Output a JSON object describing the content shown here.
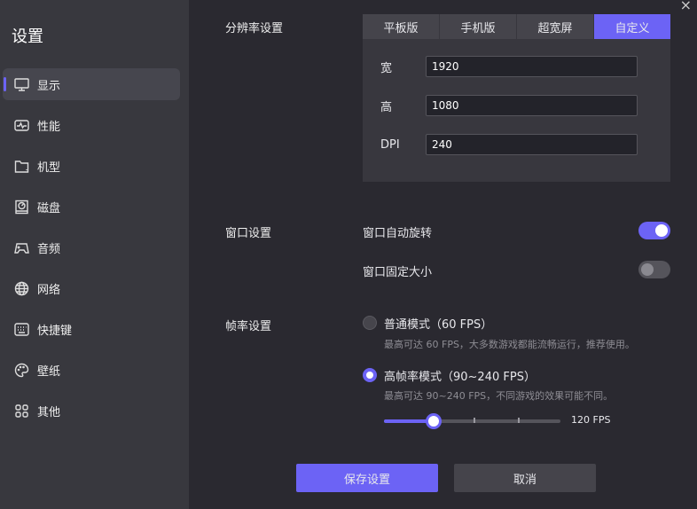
{
  "sidebar": {
    "title": "设置",
    "items": [
      {
        "label": "显示",
        "icon": "monitor-icon",
        "active": true
      },
      {
        "label": "性能",
        "icon": "performance-icon"
      },
      {
        "label": "机型",
        "icon": "folder-icon"
      },
      {
        "label": "磁盘",
        "icon": "disk-icon"
      },
      {
        "label": "音频",
        "icon": "gamepad-icon"
      },
      {
        "label": "网络",
        "icon": "globe-icon"
      },
      {
        "label": "快捷键",
        "icon": "keyboard-icon"
      },
      {
        "label": "壁纸",
        "icon": "palette-icon"
      },
      {
        "label": "其他",
        "icon": "grid-icon"
      }
    ]
  },
  "close": "×",
  "resolution": {
    "label": "分辨率设置",
    "tabs": [
      "平板版",
      "手机版",
      "超宽屏",
      "自定义"
    ],
    "active_tab": 3,
    "width_label": "宽",
    "width": "1920",
    "height_label": "高",
    "height": "1080",
    "dpi_label": "DPI",
    "dpi": "240"
  },
  "window": {
    "label": "窗口设置",
    "auto_rotate": "窗口自动旋转",
    "auto_rotate_on": true,
    "fixed_size": "窗口固定大小",
    "fixed_size_on": false
  },
  "fps": {
    "label": "帧率设置",
    "normal": {
      "title": "普通模式（60 FPS）",
      "desc": "最高可达 60 FPS，大多数游戏都能流畅运行，推荐使用。",
      "selected": false
    },
    "high": {
      "title": "高帧率模式（90~240 FPS）",
      "desc": "最高可达 90~240 FPS，不同游戏的效果可能不同。",
      "selected": true
    },
    "slider_value_label": "120 FPS",
    "slider_fraction": 0.28,
    "slider_ticks": [
      0.51,
      0.76
    ]
  },
  "buttons": {
    "save": "保存设置",
    "cancel": "取消"
  },
  "colors": {
    "accent": "#6c63f5",
    "sidebar": "#38383e",
    "background": "#2a2930"
  }
}
